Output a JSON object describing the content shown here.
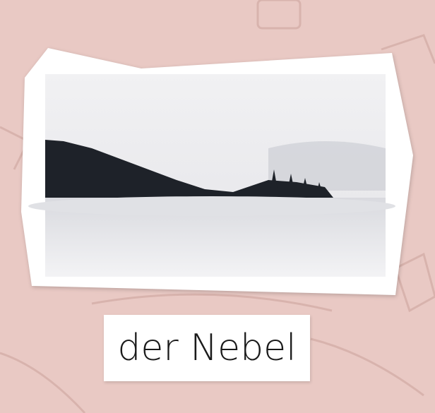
{
  "card": {
    "word": "der Nebel"
  }
}
